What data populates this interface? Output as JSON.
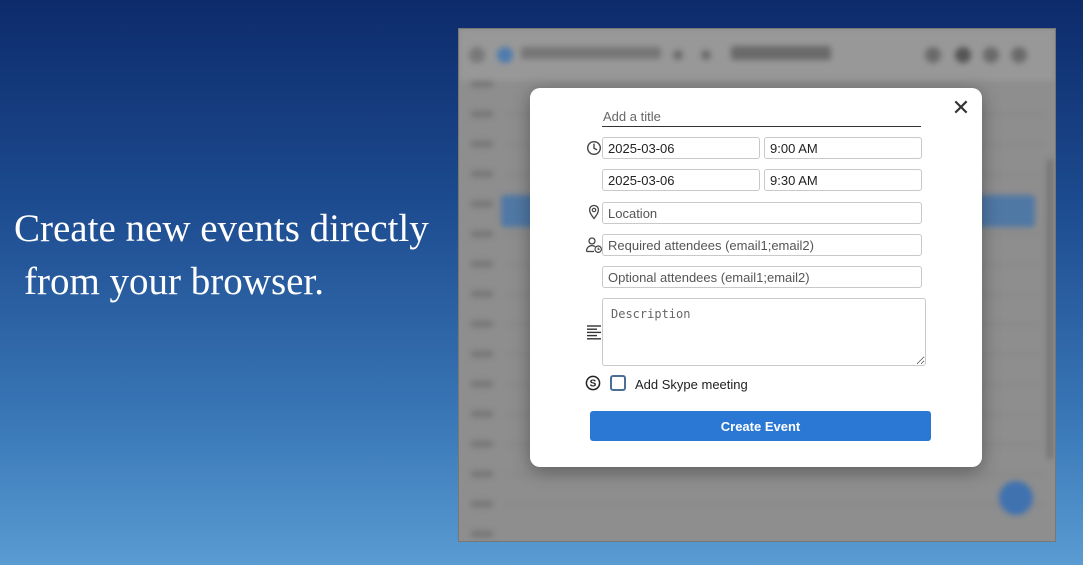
{
  "promo": {
    "line1": "Create new events directly",
    "line2": "from your browser."
  },
  "modal": {
    "close_label": "✕",
    "title_placeholder": "Add a title",
    "start_date": "2025-03-06",
    "start_time": "9:00 AM",
    "end_date": "2025-03-06",
    "end_time": "9:30 AM",
    "location_placeholder": "Location",
    "required_placeholder": "Required attendees (email1;email2)",
    "optional_placeholder": "Optional attendees (email1;email2)",
    "description_placeholder": "Description",
    "skype_label": "Add Skype meeting",
    "create_button": "Create Event"
  },
  "icons": {
    "time": "clock-icon",
    "location": "location-pin-icon",
    "attendees": "attendees-icon",
    "description": "align-left-icon",
    "skype": "skype-icon",
    "close": "close-icon"
  },
  "colors": {
    "accent": "#2a78d4",
    "checkbox_border": "#4a6f97"
  }
}
